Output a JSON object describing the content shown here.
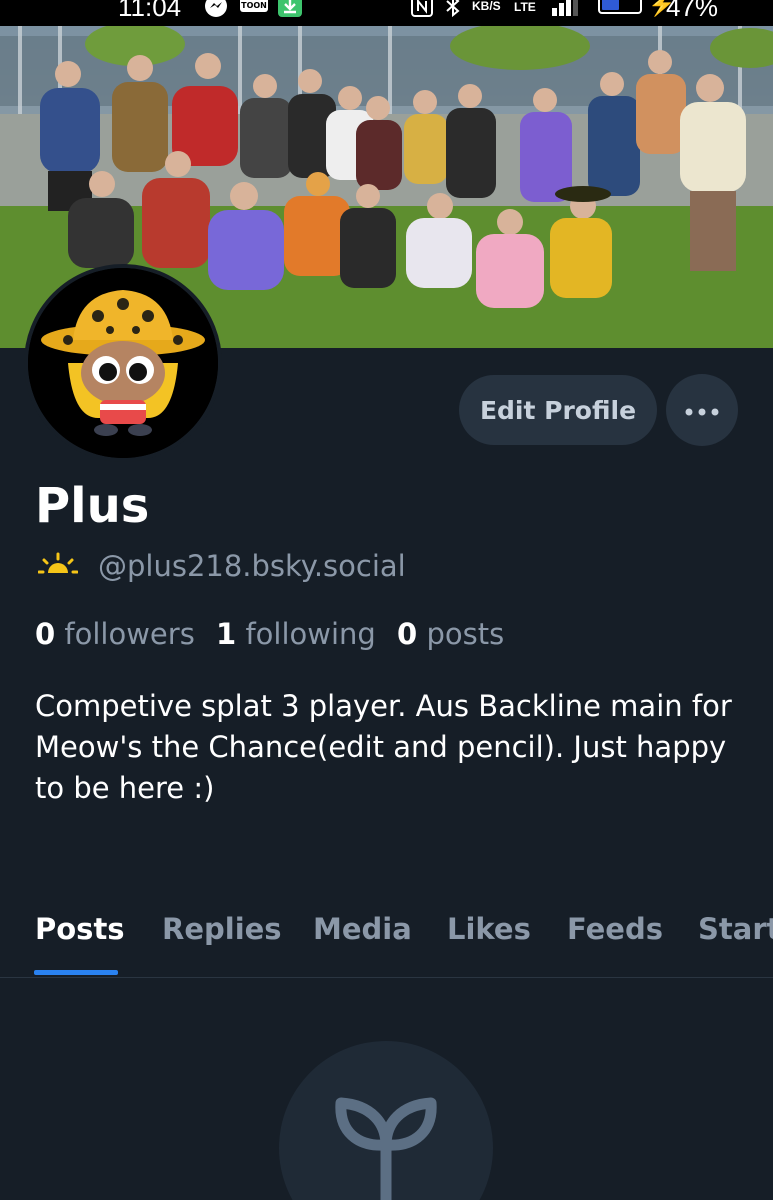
{
  "status_bar": {
    "time": "11:04",
    "net_speed_unit": "KB/S",
    "network": "LTE",
    "battery": "47%",
    "battery_level": 0.47,
    "app_icons": [
      "messenger-icon",
      "webtoon-icon",
      "download-icon",
      "nfc-icon",
      "bluetooth-icon",
      "signal-icon"
    ],
    "webtoon_label": "TOON"
  },
  "profile": {
    "display_name": "Plus",
    "handle": "@plus218.bsky.social",
    "handle_icon": "sun-icon",
    "followers_count": "0",
    "followers_label": "followers",
    "following_count": "1",
    "following_label": "following",
    "posts_count": "0",
    "posts_label": "posts",
    "bio": "Competive splat 3 player. Aus Backline main for Meow's the Chance(edit and pencil). Just happy to be here :)"
  },
  "actions": {
    "edit_profile": "Edit Profile",
    "more_icon": "ellipsis-icon"
  },
  "tabs": [
    {
      "label": "Posts",
      "active": true
    },
    {
      "label": "Replies",
      "active": false
    },
    {
      "label": "Media",
      "active": false
    },
    {
      "label": "Likes",
      "active": false
    },
    {
      "label": "Feeds",
      "active": false
    },
    {
      "label": "Starter",
      "active": false
    }
  ],
  "empty_state": {
    "icon": "sprout-icon"
  },
  "colors": {
    "background": "#161e27",
    "button": "#273340",
    "accent": "#2a82f0",
    "muted_text": "#8b98a8",
    "sun_icon": "#f5c518"
  }
}
